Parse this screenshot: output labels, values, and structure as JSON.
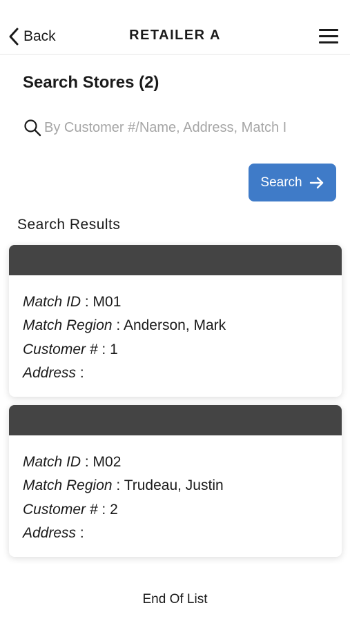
{
  "header": {
    "back_label": "Back",
    "title": "RETAILER A"
  },
  "search": {
    "title": "Search Stores (2)",
    "placeholder": "By Customer #/Name, Address, Match I",
    "button_label": "Search"
  },
  "results": {
    "label": "Search Results",
    "items": [
      {
        "match_id_label": "Match ID",
        "match_id": "M01",
        "region_label": "Match Region",
        "region": "Anderson, Mark",
        "customer_label": "Customer #",
        "customer": "1",
        "address_label": "Address",
        "address": ""
      },
      {
        "match_id_label": "Match ID",
        "match_id": "M02",
        "region_label": "Match Region",
        "region": "Trudeau, Justin",
        "customer_label": "Customer #",
        "customer": "2",
        "address_label": "Address",
        "address": ""
      }
    ],
    "end_text": "End Of List"
  },
  "colors": {
    "accent": "#3f7bc8",
    "card_header": "#444444"
  },
  "icons": {
    "back": "chevron-left-icon",
    "menu": "hamburger-menu-icon",
    "search": "search-icon",
    "arrow": "arrow-right-icon"
  }
}
